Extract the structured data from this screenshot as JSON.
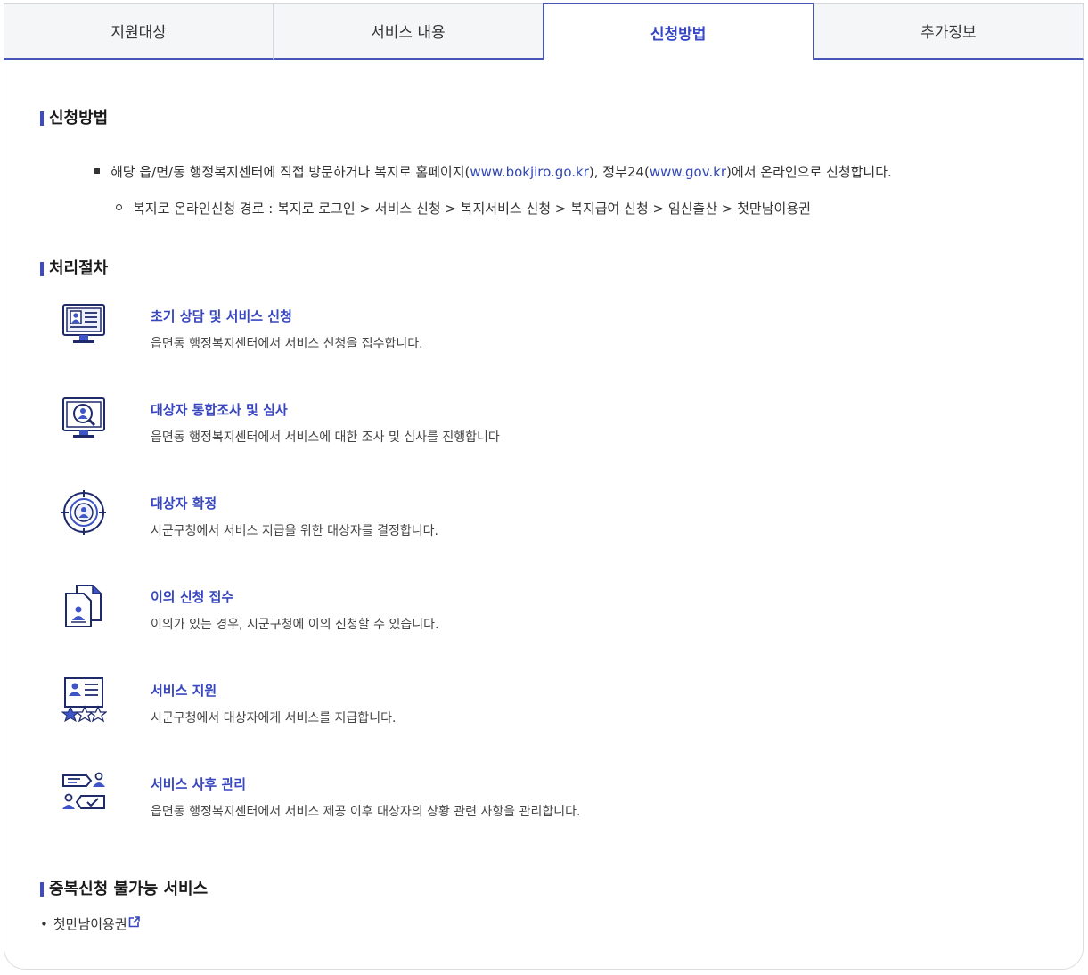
{
  "tabs": [
    {
      "label": "지원대상",
      "active": false
    },
    {
      "label": "서비스 내용",
      "active": false
    },
    {
      "label": "신청방법",
      "active": true
    },
    {
      "label": "추가정보",
      "active": false
    }
  ],
  "apply": {
    "heading": "신청방법",
    "line1_prefix": "해당 읍/면/동 행정복지센터에 직접 방문하거나 복지로 홈페이지(",
    "line1_link1": "www.bokjiro.go.kr",
    "line1_mid": "), 정부24(",
    "line1_link2": "www.gov.kr",
    "line1_suffix": ")에서 온라인으로 신청합니다.",
    "line2": "복지로 온라인신청 경로 : 복지로 로그인 > 서비스 신청 > 복지서비스 신청 > 복지급여 신청 > 임신출산 > 첫만남이용권"
  },
  "process": {
    "heading": "처리절차",
    "steps": [
      {
        "icon": "monitor-profile-icon",
        "title": "초기 상담 및 서비스 신청",
        "desc": "읍면동 행정복지센터에서 서비스 신청을 접수합니다."
      },
      {
        "icon": "monitor-search-icon",
        "title": "대상자 통합조사 및 심사",
        "desc": "읍면동 행정복지센터에서 서비스에 대한 조사 및 심사를 진행합니다"
      },
      {
        "icon": "target-person-icon",
        "title": "대상자 확정",
        "desc": "시군구청에서 서비스 지급을 위한 대상자를 결정합니다."
      },
      {
        "icon": "documents-icon",
        "title": "이의 신청 접수",
        "desc": "이의가 있는 경우, 시군구청에 이의 신청할 수 있습니다."
      },
      {
        "icon": "profile-stars-icon",
        "title": "서비스 지원",
        "desc": "시군구청에서 대상자에게 서비스를 지급합니다."
      },
      {
        "icon": "chat-check-icon",
        "title": "서비스 사후 관리",
        "desc": "읍면동 행정복지센터에서 서비스 제공 이후 대상자의 상황 관련 사항을 관리합니다."
      }
    ]
  },
  "duplicate": {
    "heading": "중복신청 불가능 서비스",
    "bullet": "•",
    "items": [
      "첫만남이용권"
    ],
    "link_icon": "external-link-icon"
  },
  "colors": {
    "accent": "#3846c0",
    "icon_dark": "#1f2a6b",
    "icon_blue": "#3e55c8"
  }
}
